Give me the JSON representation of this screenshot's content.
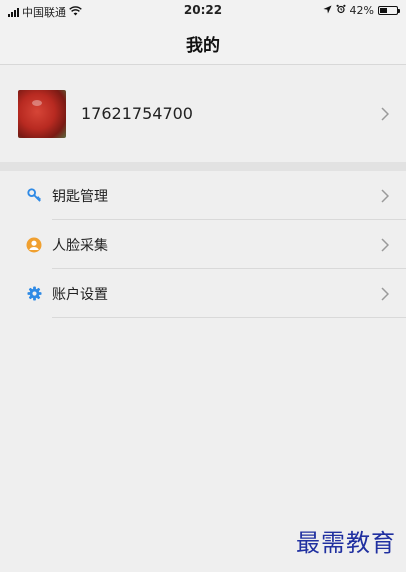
{
  "status_bar": {
    "carrier": "中国联通",
    "time": "20:22",
    "battery_percent": "42%",
    "battery_level": 0.42
  },
  "nav": {
    "title": "我的"
  },
  "profile": {
    "phone": "17621754700"
  },
  "menu": [
    {
      "label": "钥匙管理",
      "icon": "key-icon",
      "color": "#2f8ae5"
    },
    {
      "label": "人脸采集",
      "icon": "face-user-icon",
      "color": "#f0a030"
    },
    {
      "label": "账户设置",
      "icon": "gear-icon",
      "color": "#2f8ae5"
    }
  ],
  "watermark": "最需教育",
  "colors": {
    "accent_blue": "#2f8ae5",
    "accent_orange": "#f0a030",
    "watermark": "#2030a0"
  }
}
